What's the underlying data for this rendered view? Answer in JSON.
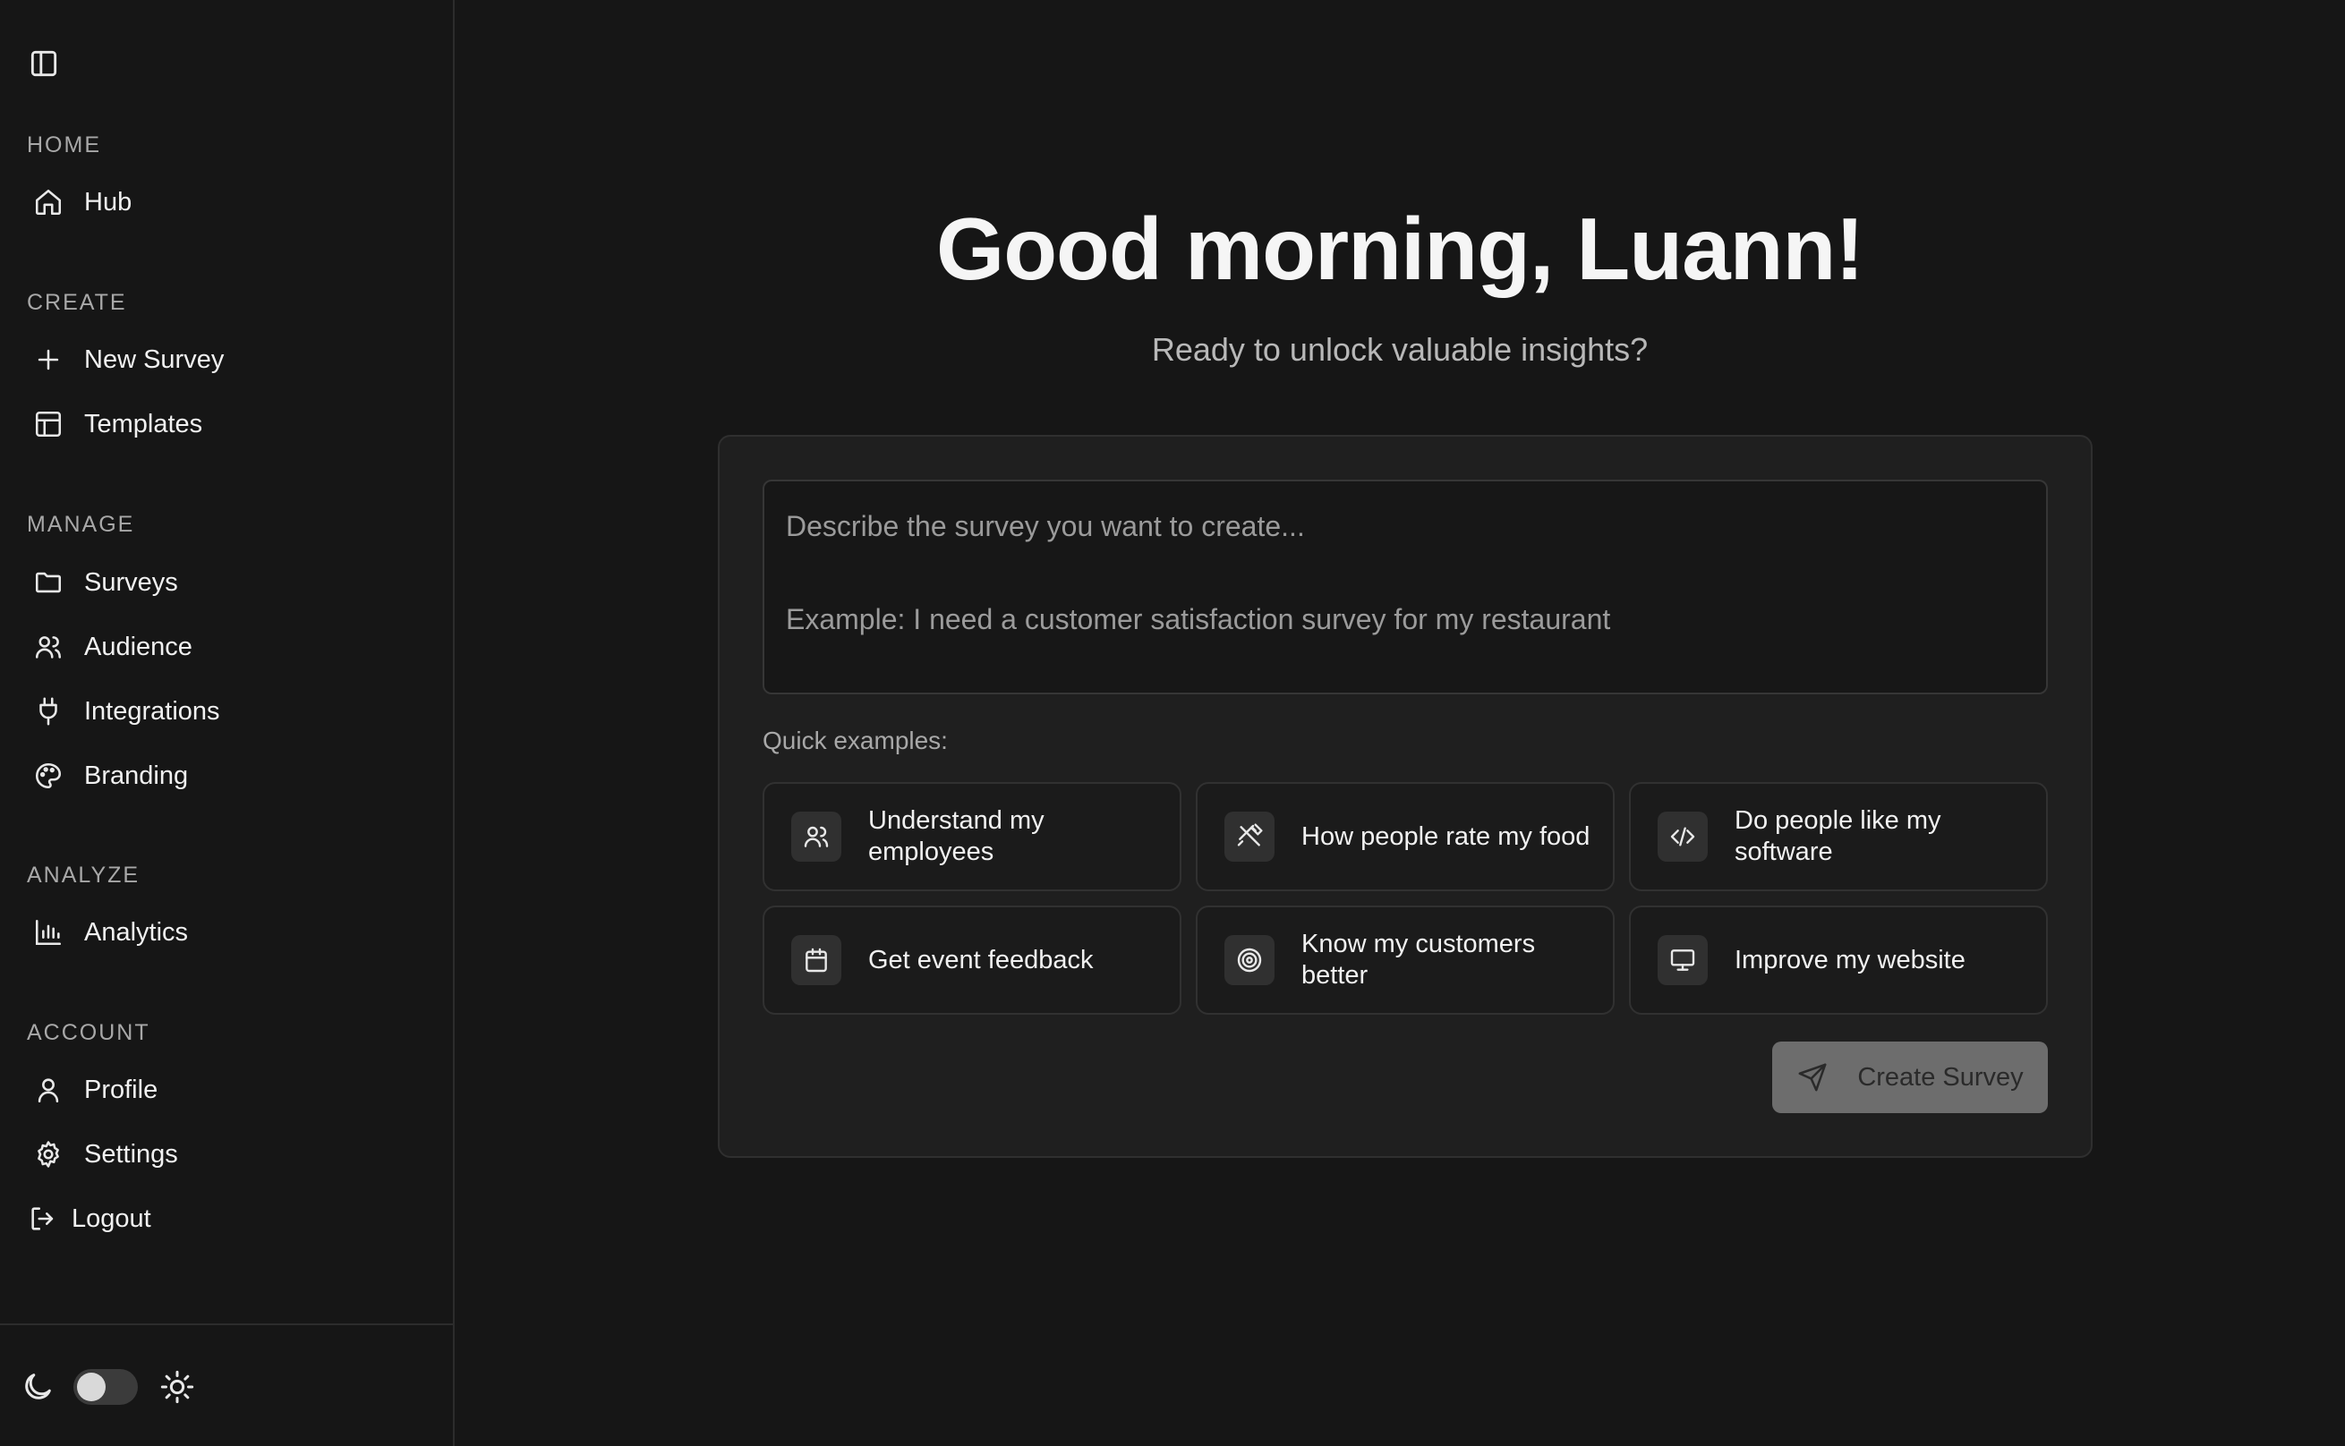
{
  "sidebar": {
    "sections": {
      "home": "HOME",
      "create": "CREATE",
      "manage": "MANAGE",
      "analyze": "ANALYZE",
      "account": "ACCOUNT"
    },
    "items": {
      "hub": "Hub",
      "new_survey": "New Survey",
      "templates": "Templates",
      "surveys": "Surveys",
      "audience": "Audience",
      "integrations": "Integrations",
      "branding": "Branding",
      "analytics": "Analytics",
      "profile": "Profile",
      "settings": "Settings",
      "logout": "Logout"
    },
    "theme_toggle": {
      "mode": "dark"
    }
  },
  "main": {
    "greeting": "Good morning, Luann!",
    "subtitle": "Ready to unlock valuable insights?",
    "prompt": {
      "placeholder_line1": "Describe the survey you want to create...",
      "placeholder_line2": "Example: I need a customer satisfaction survey for my restaurant"
    },
    "quick_label": "Quick examples:",
    "examples": [
      {
        "label": "Understand my employees",
        "icon": "users-icon"
      },
      {
        "label": "How people rate my food",
        "icon": "utensils-crossed-icon"
      },
      {
        "label": "Do people like my software",
        "icon": "code-icon"
      },
      {
        "label": "Get event feedback",
        "icon": "calendar-icon"
      },
      {
        "label": "Know my customers better",
        "icon": "target-icon"
      },
      {
        "label": "Improve my website",
        "icon": "monitor-icon"
      }
    ],
    "create_button": "Create Survey"
  },
  "colors": {
    "background": "#161616",
    "card": "#1f1f1f",
    "button_disabled": "#6d6d6d"
  }
}
